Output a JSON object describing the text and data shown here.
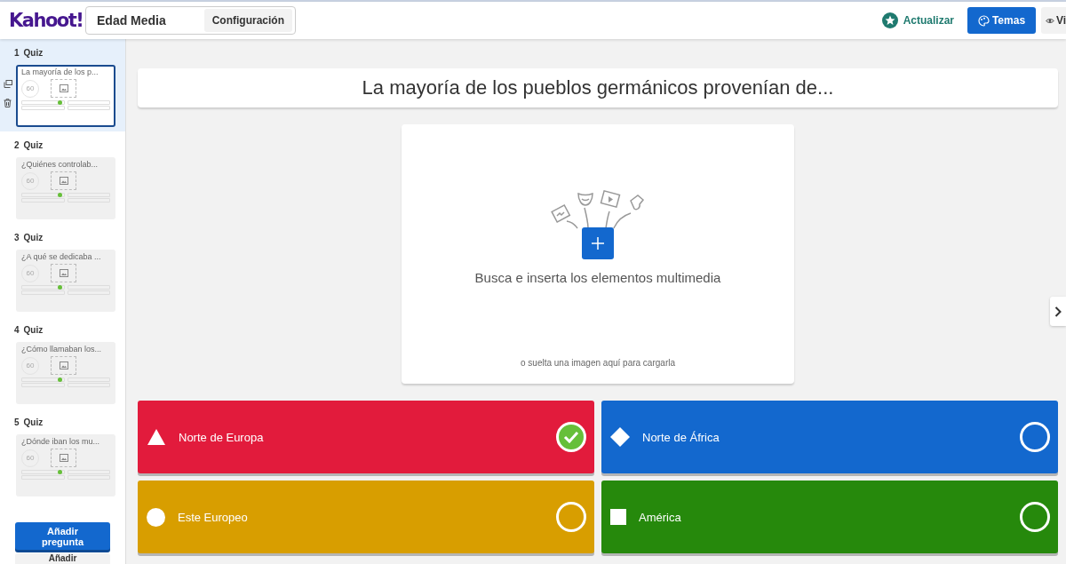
{
  "header": {
    "logo": "Kahoot!",
    "title": "Edad Media",
    "settings_button": "Configuración",
    "upgrade_link": "Actualizar",
    "themes_button": "Temas",
    "view_button": "Vi"
  },
  "slides": [
    {
      "number": "1",
      "type": "Quiz",
      "title": "La mayoría de los p...",
      "timer": "60",
      "selected": true
    },
    {
      "number": "2",
      "type": "Quiz",
      "title": "¿Quiénes controlab...",
      "timer": "60",
      "selected": false
    },
    {
      "number": "3",
      "type": "Quiz",
      "title": "¿A qué se dedicaba ...",
      "timer": "60",
      "selected": false
    },
    {
      "number": "4",
      "type": "Quiz",
      "title": "¿Cómo llamaban los...",
      "timer": "60",
      "selected": false
    },
    {
      "number": "5",
      "type": "Quiz",
      "title": "¿Dónde iban los mu...",
      "timer": "60",
      "selected": false
    }
  ],
  "sidebar_buttons": [
    "Añadir pregunta",
    "Añadir"
  ],
  "question": "La mayoría de los pueblos germánicos provenían de...",
  "media": {
    "prompt": "Busca e inserta los elementos multimedia",
    "hint": "o suelta una imagen aquí para cargarla"
  },
  "answers": [
    {
      "kind": "triangle",
      "text": "Norte de Europa",
      "color": "#e21b3c",
      "correct": true
    },
    {
      "kind": "diamond",
      "text": "Norte de África",
      "color": "#1368ce",
      "correct": false
    },
    {
      "kind": "circle",
      "text": "Este Europeo",
      "color": "#d89e00",
      "correct": false
    },
    {
      "kind": "square",
      "text": "América",
      "color": "#26890c",
      "correct": false
    }
  ]
}
